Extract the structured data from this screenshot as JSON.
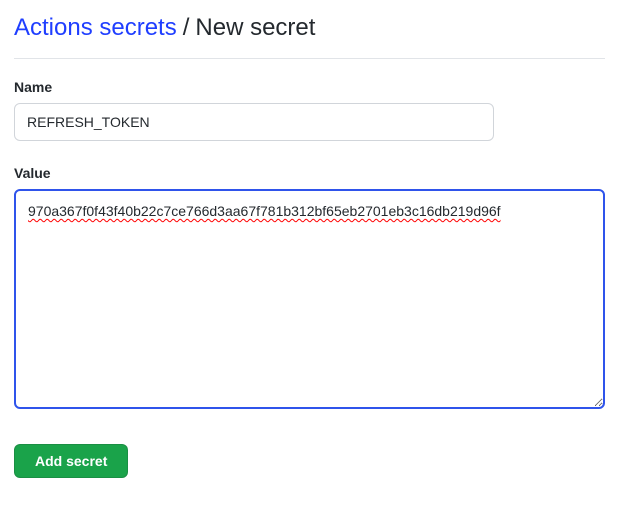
{
  "header": {
    "breadcrumb_link": "Actions secrets",
    "separator": "/",
    "current": "New secret"
  },
  "form": {
    "name_label": "Name",
    "name_value": "REFRESH_TOKEN",
    "value_label": "Value",
    "value_content": "970a367f0f43f40b22c7ce766d3aa67f781b312bf65eb2701eb3c16db219d96f",
    "submit_label": "Add secret"
  }
}
